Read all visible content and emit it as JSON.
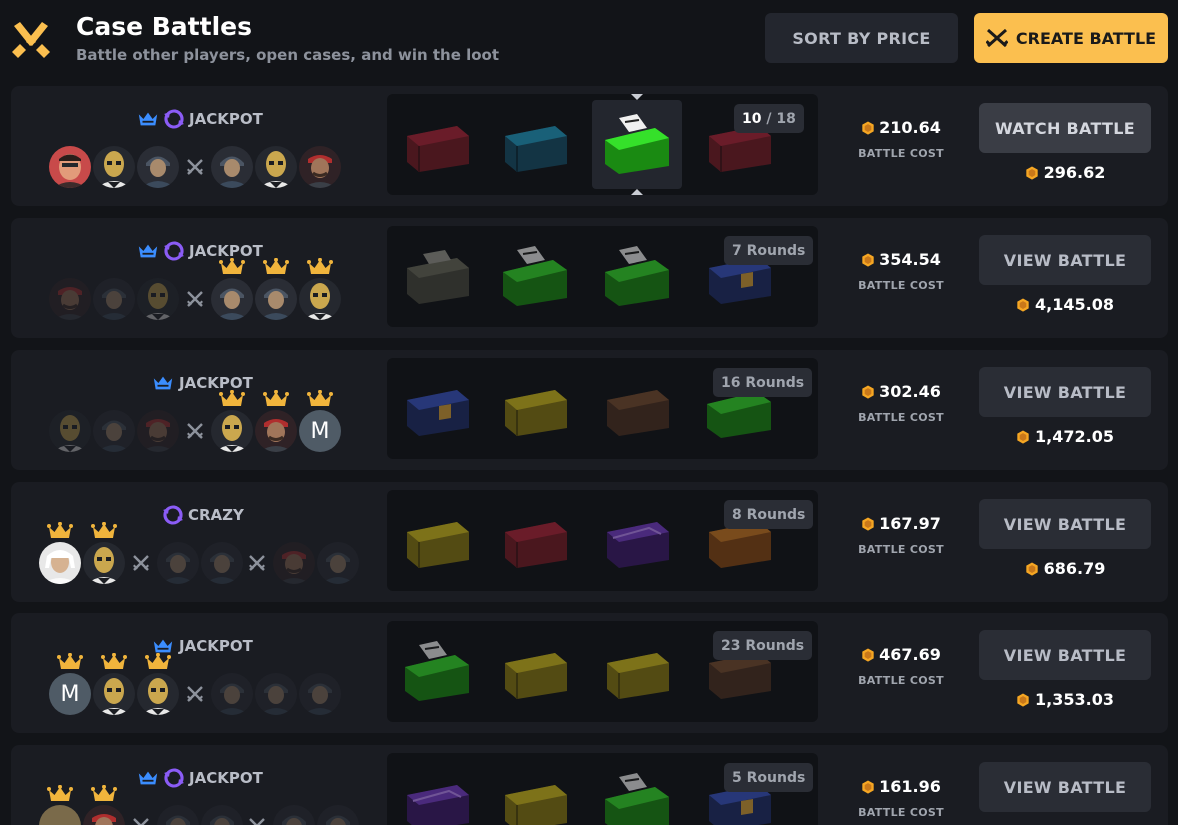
{
  "header": {
    "title": "Case Battles",
    "subtitle": "Battle other players, open cases, and win the loot",
    "sort_label": "SORT BY PRICE",
    "create_label": "CREATE BATTLE"
  },
  "colors": {
    "accent": "#fbbf4f",
    "background": "#121418",
    "card": "#1a1c22",
    "crown_blue": "#3b8dff",
    "crazy_purple": "#8b5cf6",
    "coin": "#f5a623"
  },
  "battles": [
    {
      "mode": "JACKPOT",
      "badges": [
        "crown-icon",
        "crazy-icon"
      ],
      "rounds_current": "10",
      "rounds_sep": "/",
      "rounds_total": "18",
      "cost": "210.64",
      "cost_label": "BATTLE COST",
      "button": "WATCH BATTLE",
      "total": "296.62"
    },
    {
      "mode": "JACKPOT",
      "badges": [
        "crown-icon",
        "crazy-icon"
      ],
      "rounds": "7 Rounds",
      "cost": "354.54",
      "cost_label": "BATTLE COST",
      "button": "VIEW BATTLE",
      "total": "4,145.08"
    },
    {
      "mode": "JACKPOT",
      "badges": [
        "crown-icon"
      ],
      "rounds": "16 Rounds",
      "cost": "302.46",
      "cost_label": "BATTLE COST",
      "button": "VIEW BATTLE",
      "total": "1,472.05",
      "avatar_letter": "M"
    },
    {
      "mode": "CRAZY",
      "badges": [
        "crazy-icon"
      ],
      "rounds": "8 Rounds",
      "cost": "167.97",
      "cost_label": "BATTLE COST",
      "button": "VIEW BATTLE",
      "total": "686.79"
    },
    {
      "mode": "JACKPOT",
      "badges": [
        "crown-icon"
      ],
      "rounds": "23 Rounds",
      "cost": "467.69",
      "cost_label": "BATTLE COST",
      "button": "VIEW BATTLE",
      "total": "1,353.03",
      "avatar_letter": "M"
    },
    {
      "mode": "JACKPOT",
      "badges": [
        "crown-icon",
        "crazy-icon"
      ],
      "rounds": "5 Rounds",
      "cost": "161.96",
      "cost_label": "BATTLE COST",
      "button": "VIEW BATTLE",
      "total": ""
    }
  ]
}
